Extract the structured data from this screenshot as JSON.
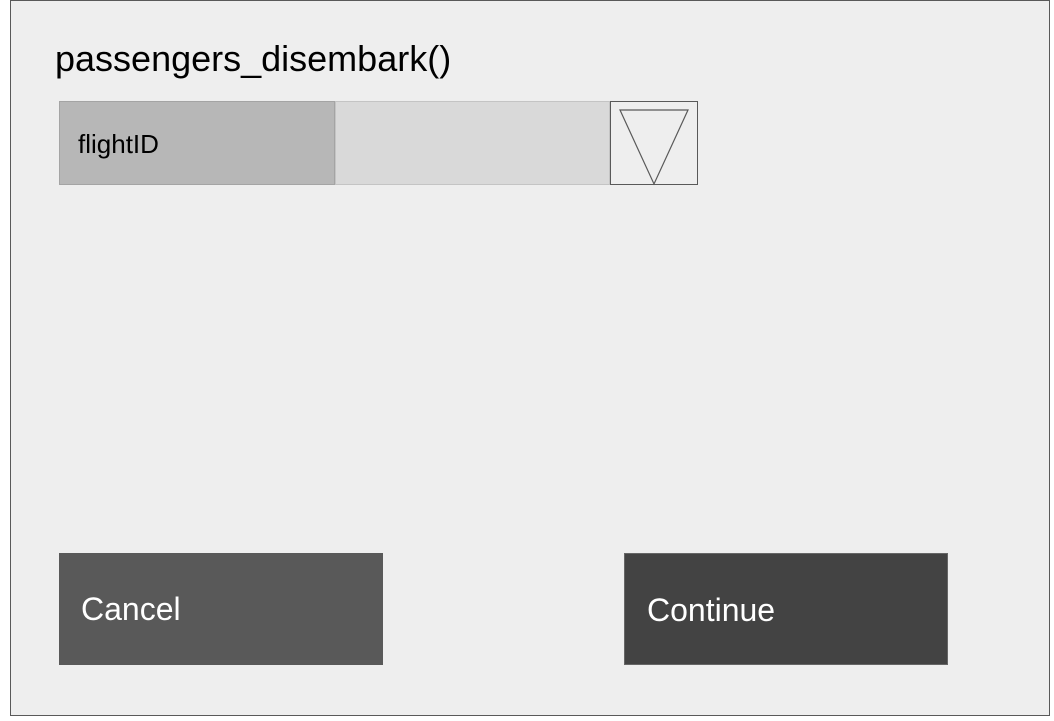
{
  "dialog": {
    "title": "passengers_disembark()"
  },
  "form": {
    "field_label": "flightID",
    "field_value": "",
    "dropdown_icon": "triangle-down-icon"
  },
  "actions": {
    "cancel_label": "Cancel",
    "continue_label": "Continue"
  },
  "colors": {
    "dialog_background": "#eeeeee",
    "label_background": "#b7b7b7",
    "value_background": "#d9d9d9",
    "cancel_background": "#595959",
    "continue_background": "#434343"
  }
}
